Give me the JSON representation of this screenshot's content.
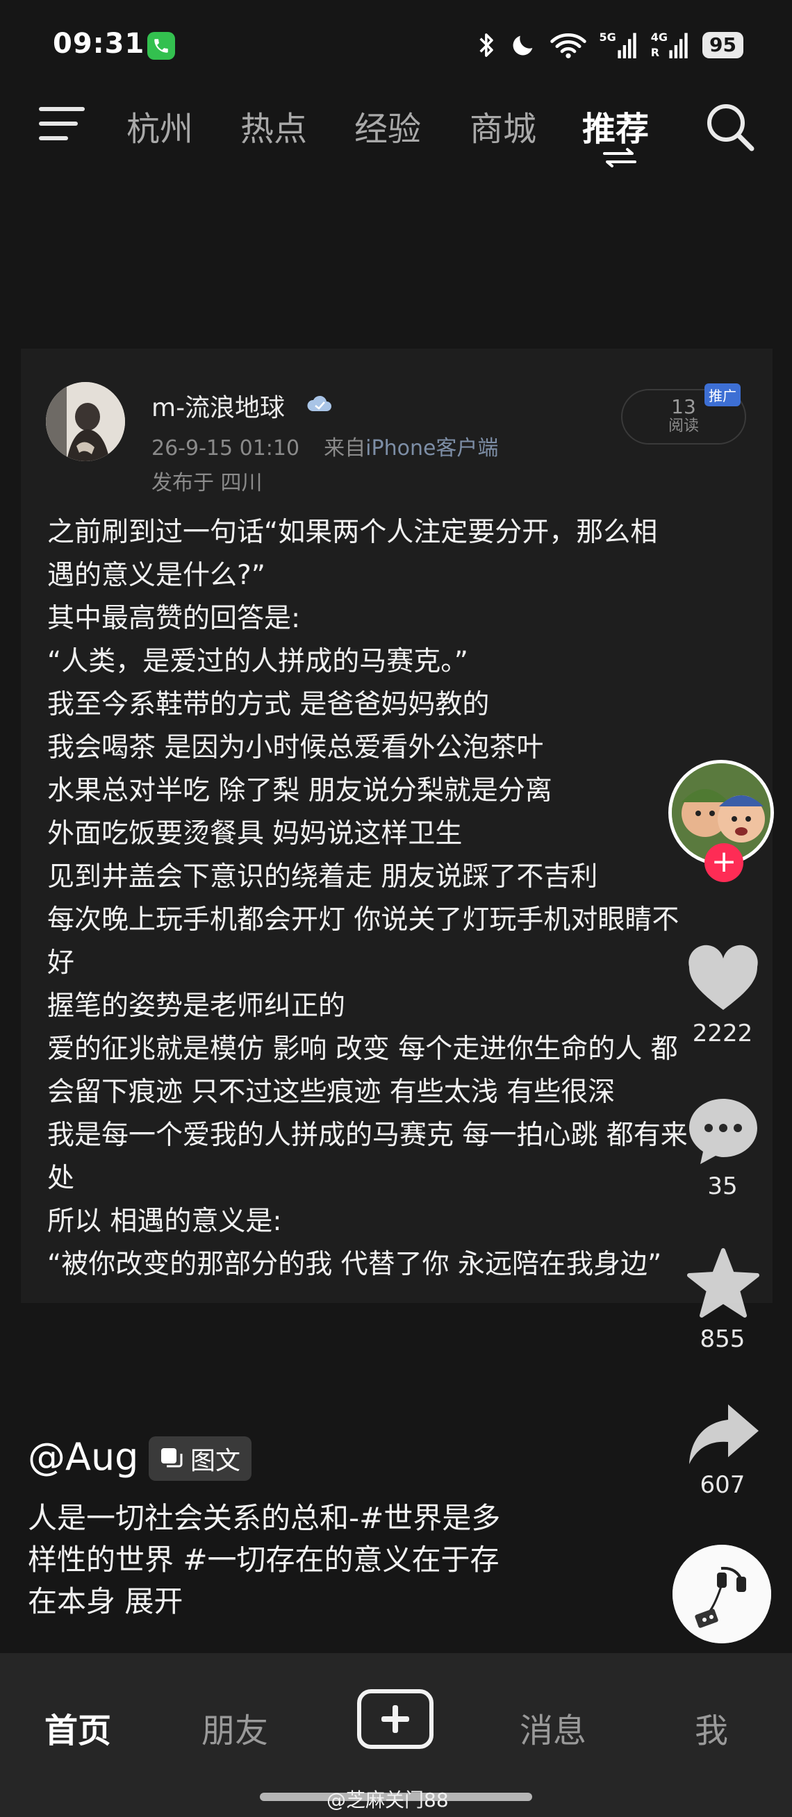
{
  "status": {
    "time": "09:31",
    "signal1": "5G",
    "signal2_r": "R",
    "signal2": "4G",
    "battery": "95"
  },
  "nav": {
    "tabs": [
      "杭州",
      "热点",
      "经验",
      "商城",
      "推荐"
    ],
    "active": "推荐"
  },
  "post": {
    "author": "m-流浪地球",
    "meta_date": "26-9-15 01:10",
    "meta_from": "来自",
    "meta_client": "iPhone客户端",
    "location": "发布于 四川",
    "read_count": "13",
    "read_label": "阅读",
    "promo": "推广",
    "lines": [
      "之前刷到过一句话“如果两个人注定要分开，那么相",
      "遇的意义是什么?”",
      "其中最高赞的回答是:",
      "“人类，是爱过的人拼成的马赛克。”",
      "我至今系鞋带的方式 是爸爸妈妈教的",
      "我会喝茶 是因为小时候总爱看外公泡茶叶",
      "水果总对半吃 除了梨 朋友说分梨就是分离",
      "外面吃饭要烫餐具 妈妈说这样卫生",
      "见到井盖会下意识的绕着走 朋友说踩了不吉利",
      "每次晚上玩手机都会开灯 你说关了灯玩手机对眼睛不",
      "好",
      "握笔的姿势是老师纠正的",
      "爱的征兆就是模仿 影响 改变  每个走进你生命的人 都",
      "会留下痕迹 只不过这些痕迹 有些太浅 有些很深",
      "我是每一个爱我的人拼成的马赛克 每一拍心跳 都有来",
      "处",
      "所以 相遇的意义是:",
      "“被你改变的那部分的我  代替了你 永远陪在我身边”"
    ]
  },
  "rail": {
    "follow": "+",
    "likes": "2222",
    "comments": "35",
    "favorites": "855",
    "shares": "607"
  },
  "caption": {
    "handle": "@Aug",
    "tag": "图文",
    "lines": [
      "人是一切社会关系的总和-#世界是多",
      "样性的世界 #一切存在的意义在于存",
      "在本身  展开"
    ]
  },
  "bottom_nav": {
    "home": "首页",
    "friends": "朋友",
    "messages": "消息",
    "me": "我"
  },
  "watermark": "@芝麻关门88",
  "colors": {
    "background": "#161616",
    "card": "#1e1e1e",
    "follow": "#fe2c55",
    "promo": "#3d6fd4"
  }
}
